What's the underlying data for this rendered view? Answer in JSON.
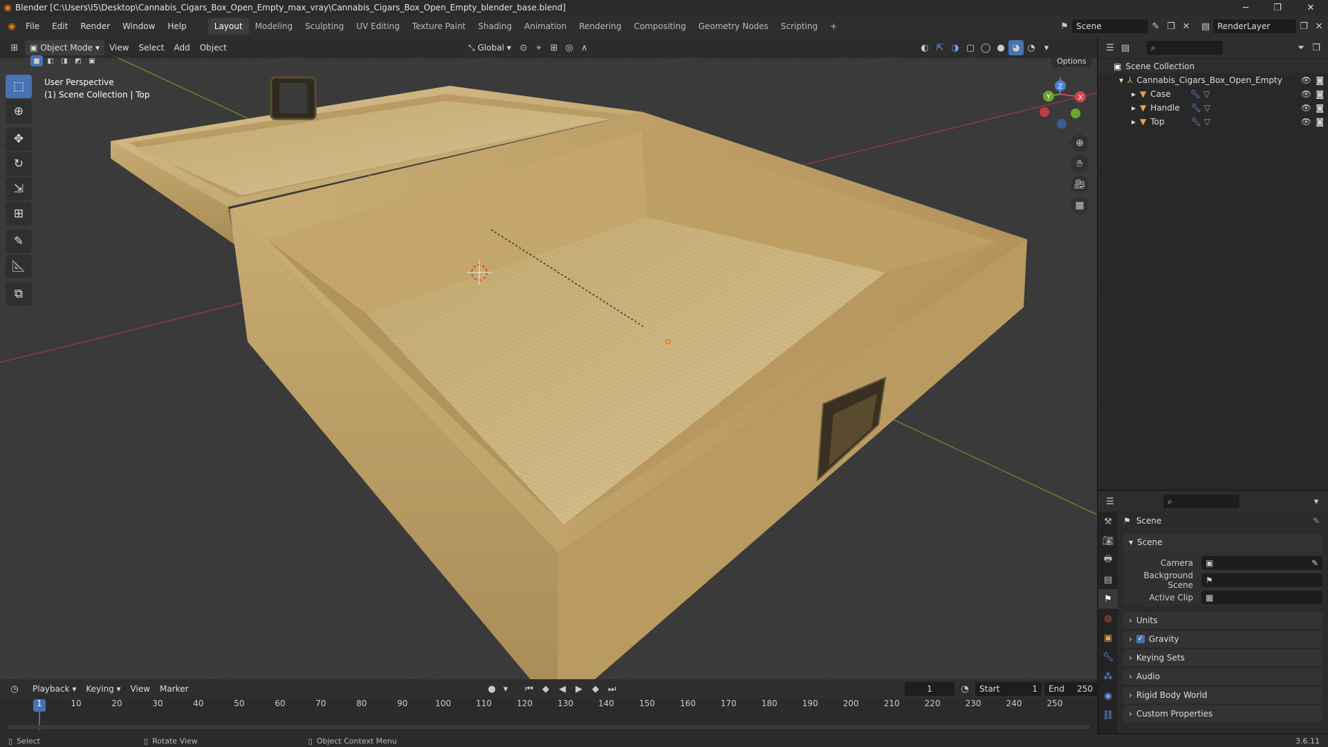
{
  "window": {
    "title": "Blender [C:\\Users\\I5\\Desktop\\Cannabis_Cigars_Box_Open_Empty_max_vray\\Cannabis_Cigars_Box_Open_Empty_blender_base.blend]",
    "minimize": "─",
    "maximize": "❐",
    "close": "✕"
  },
  "menus": [
    "File",
    "Edit",
    "Render",
    "Window",
    "Help"
  ],
  "workspaces": [
    "Layout",
    "Modeling",
    "Sculpting",
    "UV Editing",
    "Texture Paint",
    "Shading",
    "Animation",
    "Rendering",
    "Compositing",
    "Geometry Nodes",
    "Scripting",
    "+"
  ],
  "scene_selector": {
    "value": "Scene"
  },
  "view_layer": {
    "value": "RenderLayer"
  },
  "viewport": {
    "mode": "Object Mode",
    "menus": [
      "View",
      "Select",
      "Add",
      "Object"
    ],
    "transform_orientation": "Global",
    "options_label": "Options",
    "overlay_line1": "User Perspective",
    "overlay_line2": "(1) Scene Collection | Top",
    "gizmo": {
      "x": "X",
      "y": "Y",
      "z": "Z"
    }
  },
  "outliner": {
    "root": "Scene Collection",
    "collection": "Cannabis_Cigars_Box_Open_Empty",
    "objects": [
      "Case",
      "Handle",
      "Top"
    ]
  },
  "properties": {
    "context": "Scene",
    "panel_scene": "Scene",
    "camera_label": "Camera",
    "background_scene_label": "Background Scene",
    "active_clip_label": "Active Clip",
    "collapsed_panels": [
      "Units",
      "Gravity",
      "Keying Sets",
      "Audio",
      "Rigid Body World",
      "Custom Properties"
    ],
    "gravity_checked": true
  },
  "timeline": {
    "menus": [
      "Playback",
      "Keying",
      "View",
      "Marker"
    ],
    "current_frame": "1",
    "start_label": "Start",
    "start": "1",
    "end_label": "End",
    "end": "250",
    "ticks": [
      "1",
      "10",
      "20",
      "30",
      "40",
      "50",
      "60",
      "70",
      "80",
      "90",
      "100",
      "110",
      "120",
      "130",
      "140",
      "150",
      "160",
      "170",
      "180",
      "190",
      "200",
      "210",
      "220",
      "230",
      "240",
      "250"
    ]
  },
  "statusbar": {
    "select": "Select",
    "rotate": "Rotate View",
    "context_menu": "Object Context Menu",
    "version": "3.6.11"
  }
}
